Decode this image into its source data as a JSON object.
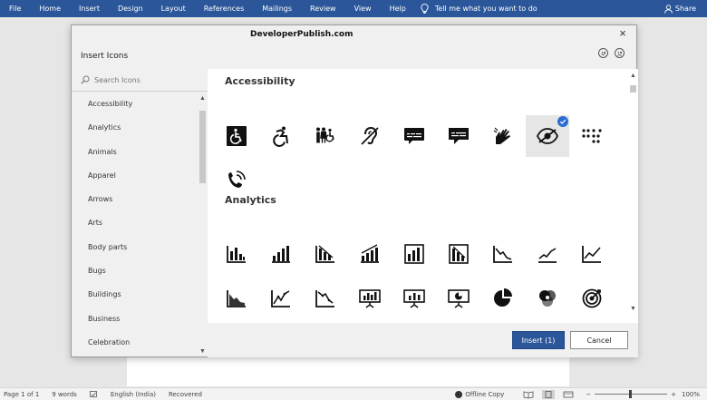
{
  "ribbon": {
    "tabs": [
      "File",
      "Home",
      "Insert",
      "Design",
      "Layout",
      "References",
      "Mailings",
      "Review",
      "View",
      "Help"
    ],
    "tell_me": "Tell me what you want to do",
    "share": "Share"
  },
  "dialog": {
    "title": "DeveloperPublish.com",
    "heading": "Insert Icons",
    "close": "×",
    "search_placeholder": "Search Icons",
    "categories": [
      "Accessibility",
      "Analytics",
      "Animals",
      "Apparel",
      "Arrows",
      "Arts",
      "Body parts",
      "Bugs",
      "Buildings",
      "Business",
      "Celebration"
    ],
    "sections": [
      {
        "title": "Accessibility",
        "icons": [
          "wheelchair-box-icon",
          "wheelchair-active-icon",
          "family-restroom-icon",
          "hearing-impaired-icon",
          "closed-captions-icon",
          "chat-captions-icon",
          "sign-language-icon",
          "low-vision-icon",
          "braille-icon",
          "tty-phone-icon"
        ],
        "selected_index": 7
      },
      {
        "title": "Analytics",
        "icons": [
          "bar-chart-icon",
          "bar-chart-rising-icon",
          "bar-chart-trend-down-icon",
          "bar-chart-trend-up-icon",
          "bar-chart-framed-icon",
          "bar-chart-framed-down-icon",
          "line-chart-down-icon",
          "line-chart-up-icon",
          "line-chart-rising-icon",
          "area-chart-down-icon",
          "area-chart-up-icon",
          "scatter-down-icon",
          "presentation-bar-icon",
          "presentation-chart-icon",
          "presentation-pie-icon",
          "pie-chart-icon",
          "venn-diagram-icon",
          "target-icon",
          "crosshair-icon",
          "speedometer-icon",
          "hourglass-icon",
          "stopwatch-icon",
          "gear-icon",
          "gear-person-icon",
          "brain-gear-icon",
          "lightbulb-icon",
          "circle-icon"
        ]
      }
    ],
    "insert_label": "Insert (1)",
    "cancel_label": "Cancel"
  },
  "status": {
    "page": "Page 1 of 1",
    "words": "9 words",
    "language": "English (India)",
    "recovered": "Recovered",
    "offline": "Offline Copy",
    "zoom": "100%",
    "minus": "−",
    "plus": "+"
  }
}
